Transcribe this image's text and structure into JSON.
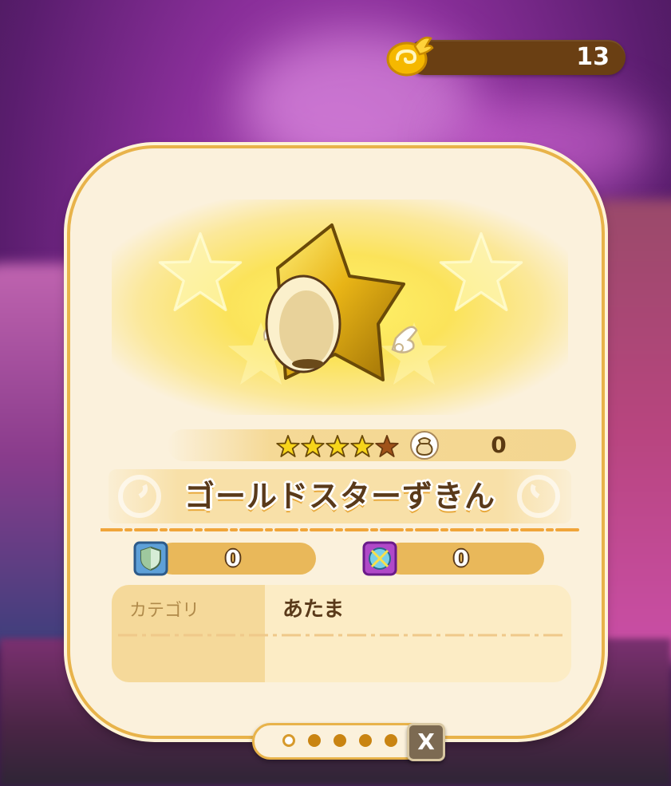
{
  "currency": {
    "value": "13",
    "icon": "wing-coin-icon"
  },
  "item": {
    "name": "ゴールドスターずきん",
    "icon": "gold-star-hood-icon",
    "rarity_stars": 5,
    "rarity_filled": 4,
    "level": "0"
  },
  "stats": [
    {
      "icon": "shield-icon",
      "value": "0"
    },
    {
      "icon": "crystal-orb-icon",
      "value": "0"
    }
  ],
  "info": {
    "category_label": "カテゴリ",
    "category_value": "あたま"
  },
  "pager": {
    "count": 5,
    "active_index": 0,
    "close_label": "X"
  },
  "colors": {
    "gold": "#e8b34a",
    "brown": "#5a3a1a",
    "cream": "#fbf1dc"
  }
}
